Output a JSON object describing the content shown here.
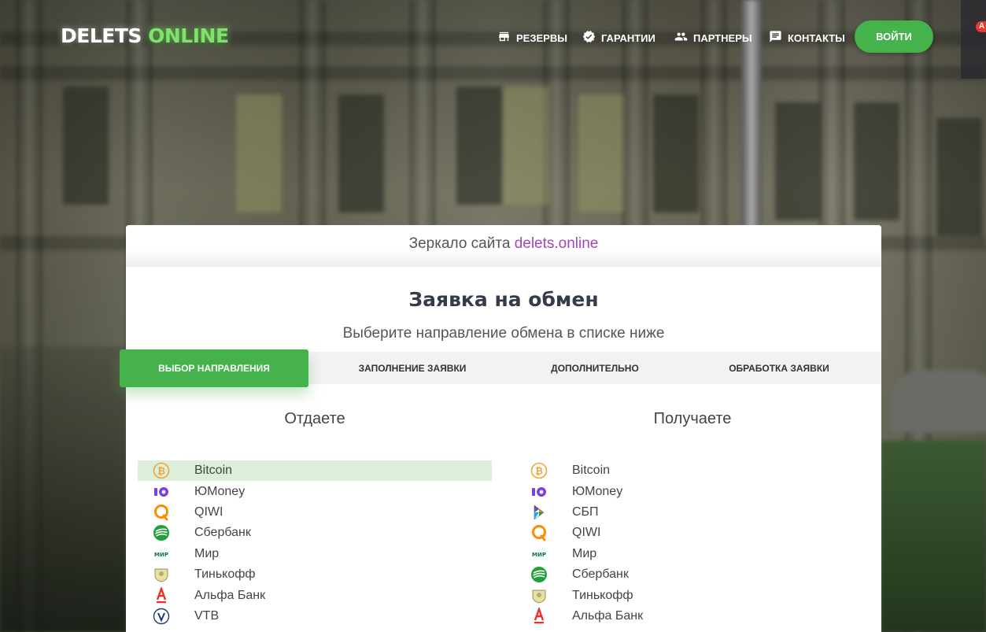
{
  "header": {
    "logo_main": "DELETS ",
    "logo_accent": "ONLINE",
    "nav": {
      "reserves": "РЕЗЕРВЫ",
      "guarantees": "ГАРАНТИИ",
      "partners": "ПАРТНЕРЫ",
      "contacts": "КОНТАКТЫ"
    },
    "login": "ВОЙТИ",
    "badge": "A"
  },
  "mirror": {
    "prefix": "Зеркало сайта ",
    "link": "delets.online"
  },
  "page": {
    "title": "Заявка на обмен",
    "subtitle": "Выберите направление обмена в списке ниже"
  },
  "steps": [
    "ВЫБОР НАПРАВЛЕНИЯ",
    "ЗАПОЛНЕНИЕ ЗАЯВКИ",
    "ДОПОЛНИТЕЛЬНО",
    "ОБРАБОТКА ЗАЯВКИ"
  ],
  "give": {
    "heading": "Отдаете",
    "selected": "Bitcoin",
    "items": [
      "Bitcoin",
      "ЮMoney",
      "QIWI",
      "Сбербанк",
      "Мир",
      "Тинькофф",
      "Альфа Банк",
      "VTB"
    ]
  },
  "get": {
    "heading": "Получаете",
    "items": [
      "Bitcoin",
      "ЮMoney",
      "СБП",
      "QIWI",
      "Мир",
      "Сбербанк",
      "Тинькофф",
      "Альфа Банк"
    ]
  },
  "colors": {
    "accent_green": "#45b24c",
    "selected_row": "#dcefd9",
    "link_purple": "#a146b8",
    "title": "#333c48"
  },
  "icons": {
    "give": [
      "bitcoin-icon",
      "yoomoney-icon",
      "qiwi-icon",
      "sberbank-icon",
      "mir-icon",
      "tinkoff-icon",
      "alfa-bank-icon",
      "vtb-icon"
    ],
    "get": [
      "bitcoin-icon",
      "yoomoney-icon",
      "sbp-icon",
      "qiwi-icon",
      "mir-icon",
      "sberbank-icon",
      "tinkoff-icon",
      "alfa-bank-icon"
    ]
  }
}
